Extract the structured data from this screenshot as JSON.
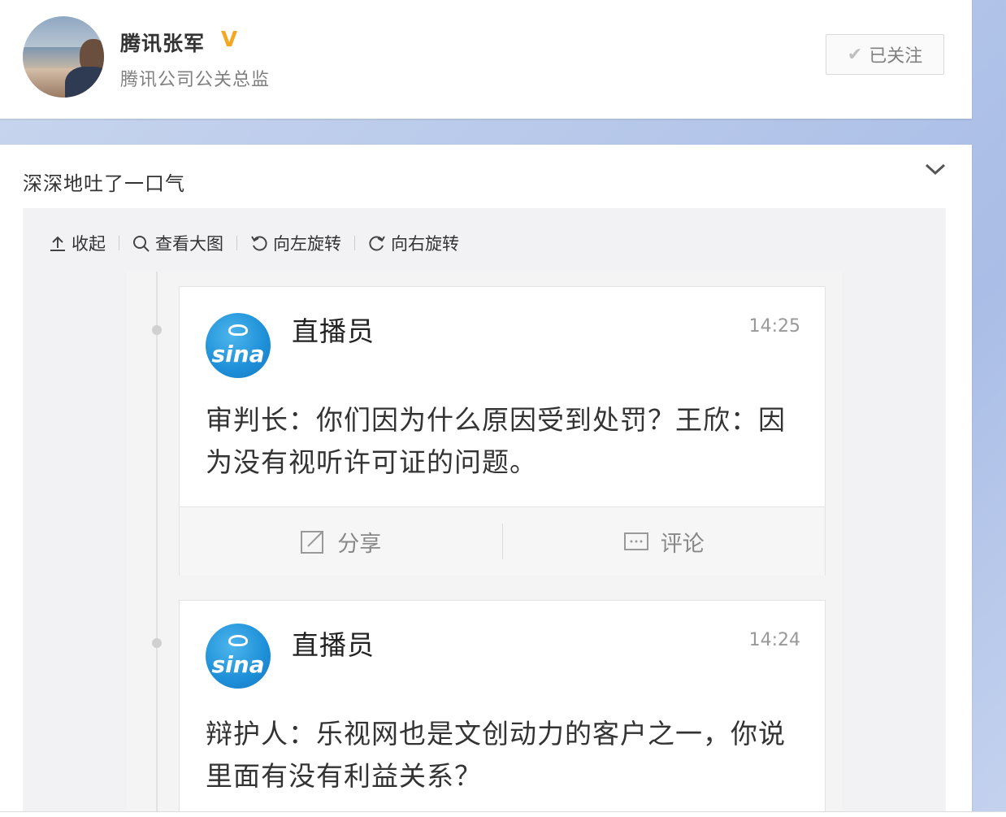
{
  "profile": {
    "name": "腾讯张军",
    "verified_badge": "V",
    "title": "腾讯公司公关总监",
    "follow_label": "已关注",
    "follow_icon": "check-icon"
  },
  "post": {
    "text": "深深地吐了一口气",
    "expand_icon": "chevron-down-icon",
    "toolbar": {
      "collapse": "收起",
      "view_large": "查看大图",
      "rotate_left": "向左旋转",
      "rotate_right": "向右旋转"
    },
    "live_items": [
      {
        "announcer": "直播员",
        "time": "14:25",
        "text": "审判长：你们因为什么原因受到处罚？王欣：因为没有视听许可证的问题。",
        "share": "分享",
        "comment": "评论"
      },
      {
        "announcer": "直播员",
        "time": "14:24",
        "text": "辩护人：乐视网也是文创动力的客户之一，你说里面有没有利益关系？"
      }
    ],
    "logo_text": "sina"
  },
  "colors": {
    "verified": "#f5a623",
    "sina_blue": "#1d8fd8",
    "background": "#b7c8ea"
  }
}
